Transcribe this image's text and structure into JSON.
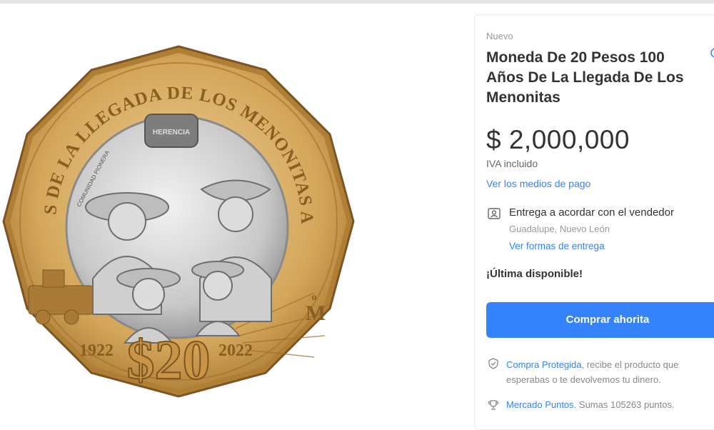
{
  "product": {
    "condition": "Nuevo",
    "title": "Moneda De 20 Pesos 100 Años De La Llegada De Los Menonitas",
    "price": "$ 2,000,000",
    "tax_note": "IVA incluido",
    "payment_link": "Ver los medios de pago"
  },
  "shipping": {
    "title": "Entrega a acordar con el vendedor",
    "location": "Guadalupe, Nuevo León",
    "link": "Ver formas de entrega"
  },
  "stock_note": "¡Última disponible!",
  "buy_button": "Comprar ahorita",
  "protection": {
    "link": "Compra Protegida",
    "text": ", recibe el producto que esperabas o te devolvemos tu dinero."
  },
  "points": {
    "link": "Mercado Puntos",
    "text": ". Sumas 105263 puntos."
  },
  "coin": {
    "legend": "CIEN AÑOS DE LA LLEGADA DE LOS MENONITAS A MÉXICO",
    "badge": "HERENCIA",
    "small_text": "COMUNIDAD PIONERA",
    "year_left": "1922",
    "year_right": "2022",
    "denomination": "$20",
    "mint_mark": "M",
    "mint_o": "o"
  },
  "colors": {
    "accent": "#3483fa",
    "ring": "#c99a4a",
    "center": "#c9c9c9"
  },
  "icons": [
    "favorite-icon",
    "location-pin-icon",
    "shield-icon",
    "trophy-icon"
  ]
}
